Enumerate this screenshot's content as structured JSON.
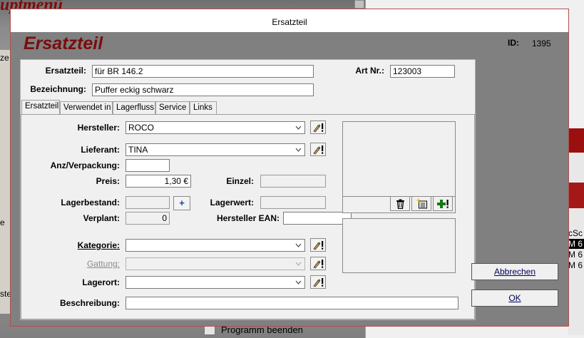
{
  "background": {
    "title_fragment": "uptmenü",
    "side_snippets": [
      "ze",
      "e",
      "ste"
    ],
    "right_snippets": [
      "cSc",
      "M 6",
      "M 6",
      "M 6"
    ],
    "bottom_item": "Programm beenden"
  },
  "dialog": {
    "window_title": "Ersatzteil",
    "heading": "Ersatzteil",
    "id_label": "ID:",
    "id_value": "1395"
  },
  "form": {
    "ersatzteil_label": "Ersatzteil:",
    "ersatzteil_value": "für BR 146.2",
    "artnr_label": "Art Nr.:",
    "artnr_value": "123003",
    "bezeichnung_label": "Bezeichnung:",
    "bezeichnung_value": "Puffer eckig schwarz"
  },
  "tabs": [
    "Ersatzteil",
    "Verwendet in",
    "Lagerfluss",
    "Service",
    "Links"
  ],
  "panel": {
    "hersteller_label": "Hersteller:",
    "hersteller_value": "ROCO",
    "lieferant_label": "Lieferant:",
    "lieferant_value": "TINA",
    "anz_label": "Anz/Verpackung:",
    "anz_value": "",
    "preis_label": "Preis:",
    "preis_value": "1,30 €",
    "einzel_label": "Einzel:",
    "einzel_value": "",
    "lagerbestand_label": "Lagerbestand:",
    "lagerbestand_value": "",
    "plus_label": "+",
    "lagerwert_label": "Lagerwert:",
    "lagerwert_value": "",
    "verplant_label": "Verplant:",
    "verplant_value": "0",
    "ean_label": "Hersteller EAN:",
    "ean_value": "",
    "kategorie_label": "Kategorie:",
    "kategorie_value": "",
    "gattung_label": "Gattung:",
    "gattung_value": "",
    "lagerort_label": "Lagerort:",
    "lagerort_value": "",
    "beschreibung_label": "Beschreibung:",
    "beschreibung_value": ""
  },
  "buttons": {
    "abbrechen": "Abbrechen",
    "ok": "OK"
  },
  "icons": {
    "edit": "pencil-exclaim-icon",
    "delete": "trash-icon",
    "new_image": "new-image-icon",
    "add": "add-exclaim-icon",
    "dropdown": "chevron-down-icon"
  },
  "colors": {
    "heading_red": "#7a0d0d",
    "dialog_gray": "#808080",
    "panel_gray": "#f0f0f0"
  }
}
